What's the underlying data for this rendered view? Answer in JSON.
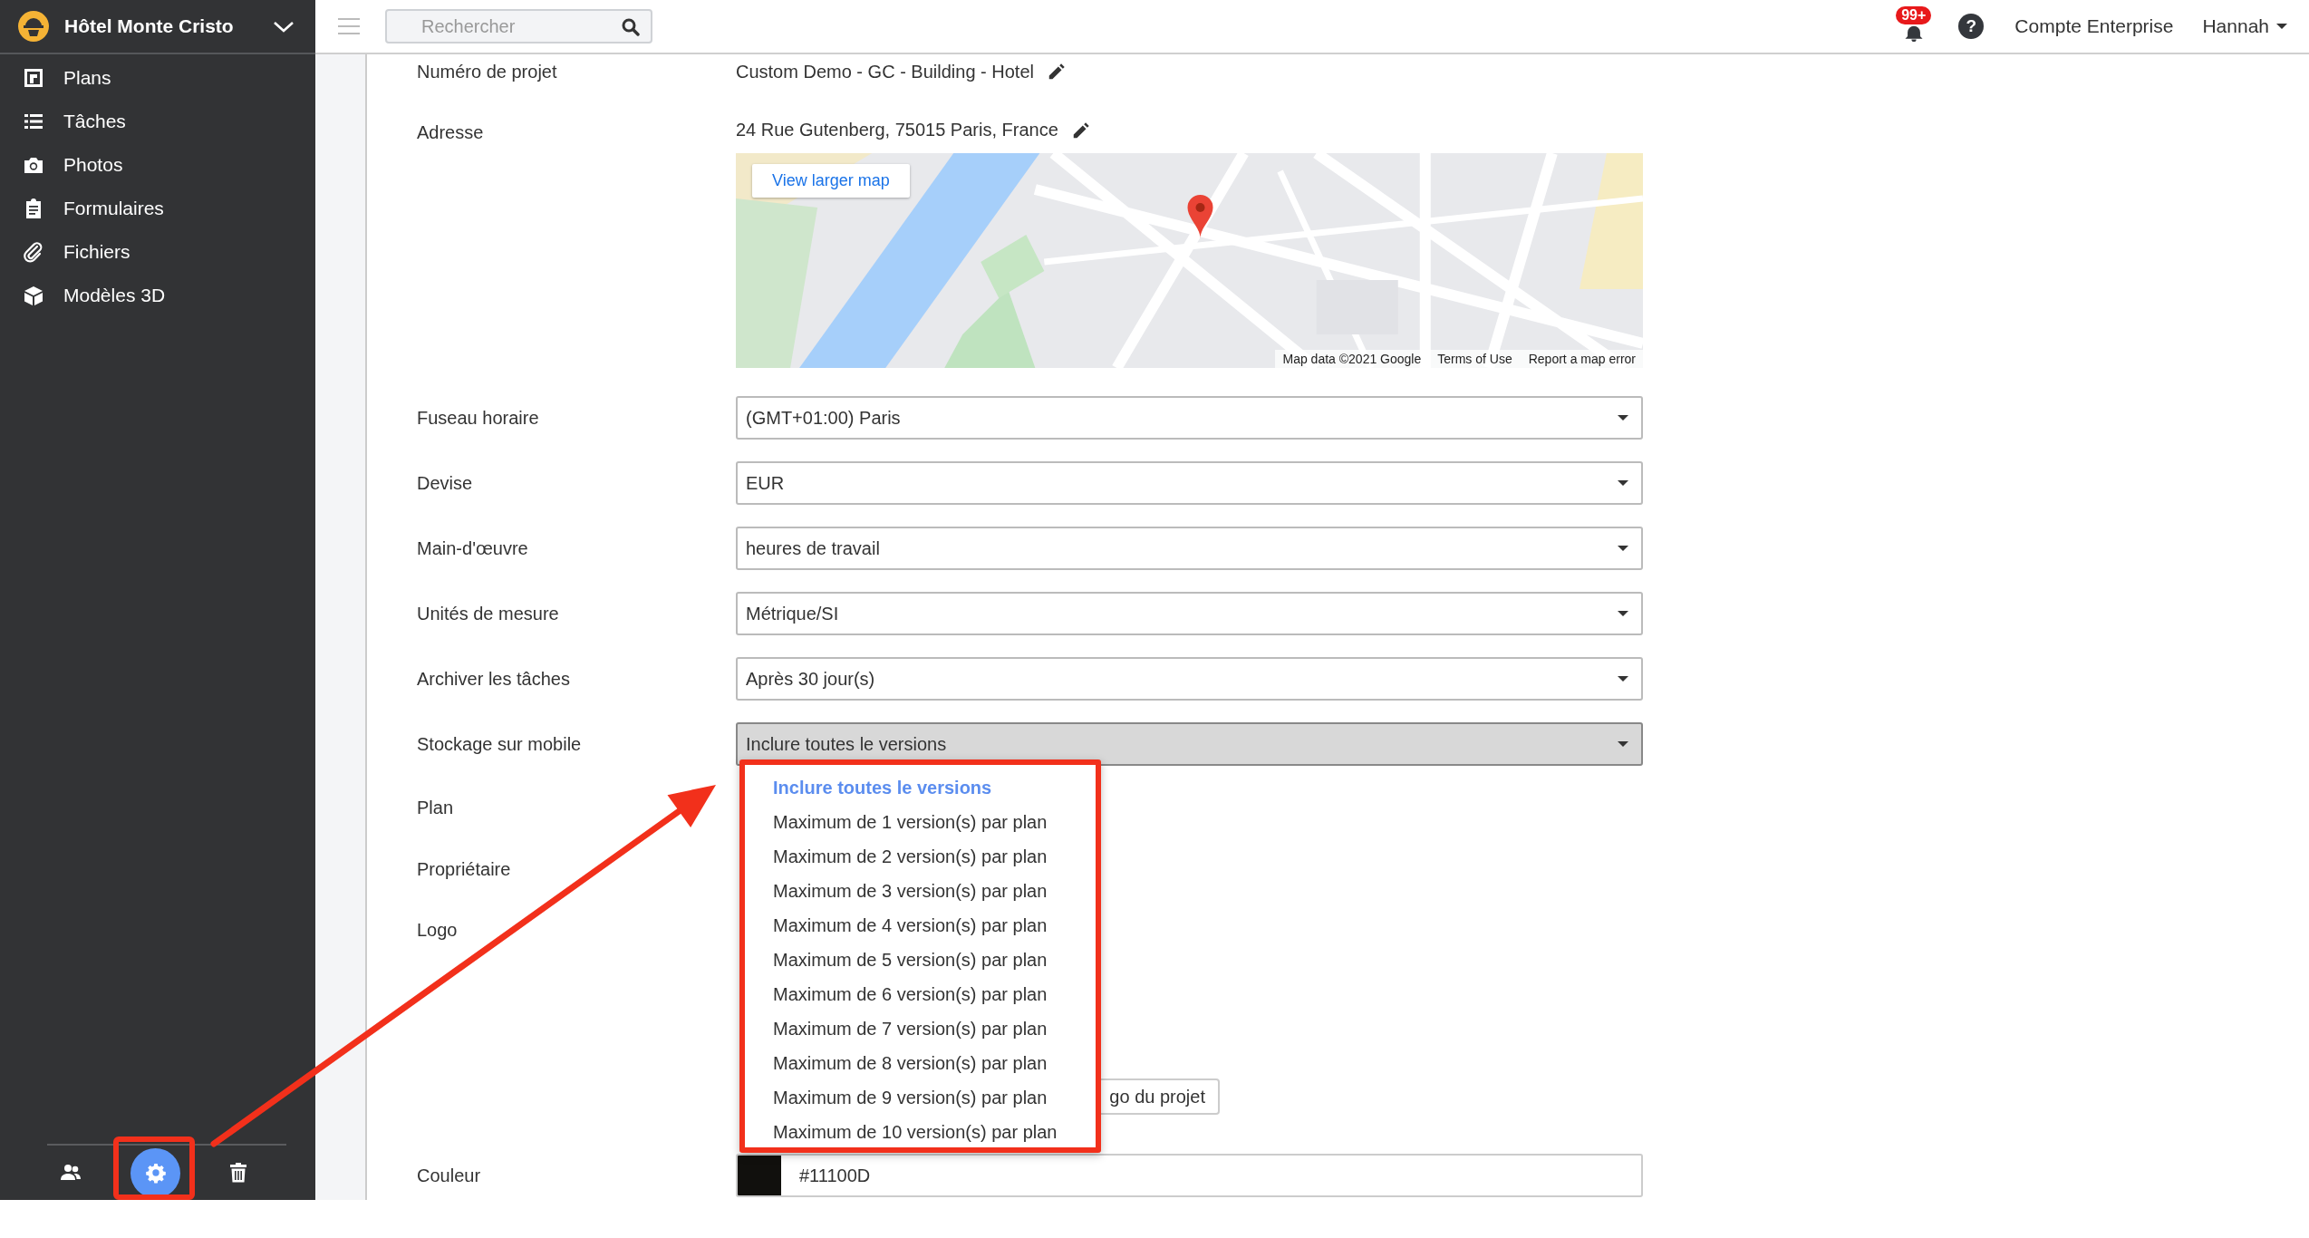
{
  "sidebar": {
    "project_name": "Hôtel Monte Cristo",
    "items": [
      {
        "label": "Plans"
      },
      {
        "label": "Tâches"
      },
      {
        "label": "Photos"
      },
      {
        "label": "Formulaires"
      },
      {
        "label": "Fichiers"
      },
      {
        "label": "Modèles 3D"
      }
    ],
    "bottom_actions": [
      {
        "selected": false
      },
      {
        "selected": true
      },
      {
        "selected": false
      }
    ]
  },
  "topbar": {
    "search": {
      "placeholder": "Rechercher"
    },
    "notifications_badge": "99+",
    "help": "?",
    "account": "Compte Enterprise",
    "user": "Hannah"
  },
  "form": {
    "rows": [
      {
        "kind": "text",
        "label": "Numéro de projet",
        "value": "Custom Demo - GC - Building - Hotel"
      },
      {
        "kind": "address",
        "label": "Adresse",
        "value": "24 Rue Gutenberg, 75015 Paris, France",
        "map": {
          "kind": "picture",
          "link": "View larger map",
          "attribution": [
            "Map data ©2021 Google",
            "Terms of Use",
            "Report a map error"
          ]
        }
      },
      {
        "kind": "select",
        "label": "Fuseau horaire",
        "value": "(GMT+01:00) Paris",
        "open": false
      },
      {
        "kind": "select",
        "label": "Devise",
        "value": "EUR",
        "open": false
      },
      {
        "kind": "select",
        "label": "Main-d'œuvre",
        "value": "heures de travail",
        "open": false
      },
      {
        "kind": "select",
        "label": "Unités de mesure",
        "value": "Métrique/SI",
        "open": false
      },
      {
        "kind": "select",
        "label": "Archiver les tâches",
        "value": "Après 30 jour(s)",
        "open": false
      },
      {
        "kind": "select",
        "label": "Stockage sur mobile",
        "value": "Inclure toutes le versions",
        "open": true,
        "options": [
          {
            "label": "Inclure toutes le versions",
            "selected": true
          },
          {
            "label": "Maximum de 1 version(s) par plan",
            "selected": false
          },
          {
            "label": "Maximum de 2 version(s) par plan",
            "selected": false
          },
          {
            "label": "Maximum de 3 version(s) par plan",
            "selected": false
          },
          {
            "label": "Maximum de 4 version(s) par plan",
            "selected": false
          },
          {
            "label": "Maximum de 5 version(s) par plan",
            "selected": false
          },
          {
            "label": "Maximum de 6 version(s) par plan",
            "selected": false
          },
          {
            "label": "Maximum de 7 version(s) par plan",
            "selected": false
          },
          {
            "label": "Maximum de 8 version(s) par plan",
            "selected": false
          },
          {
            "label": "Maximum de 9 version(s) par plan",
            "selected": false
          },
          {
            "label": "Maximum de 10 version(s) par plan",
            "selected": false
          }
        ]
      },
      {
        "kind": "blank",
        "label": "Plan"
      },
      {
        "kind": "blank",
        "label": "Propriétaire"
      },
      {
        "kind": "logo",
        "label": "Logo",
        "button": "go du projet"
      },
      {
        "kind": "color",
        "label": "Couleur",
        "value": "#11100D"
      }
    ]
  },
  "annotations": [
    {
      "kind": "box"
    },
    {
      "kind": "arrow"
    }
  ]
}
